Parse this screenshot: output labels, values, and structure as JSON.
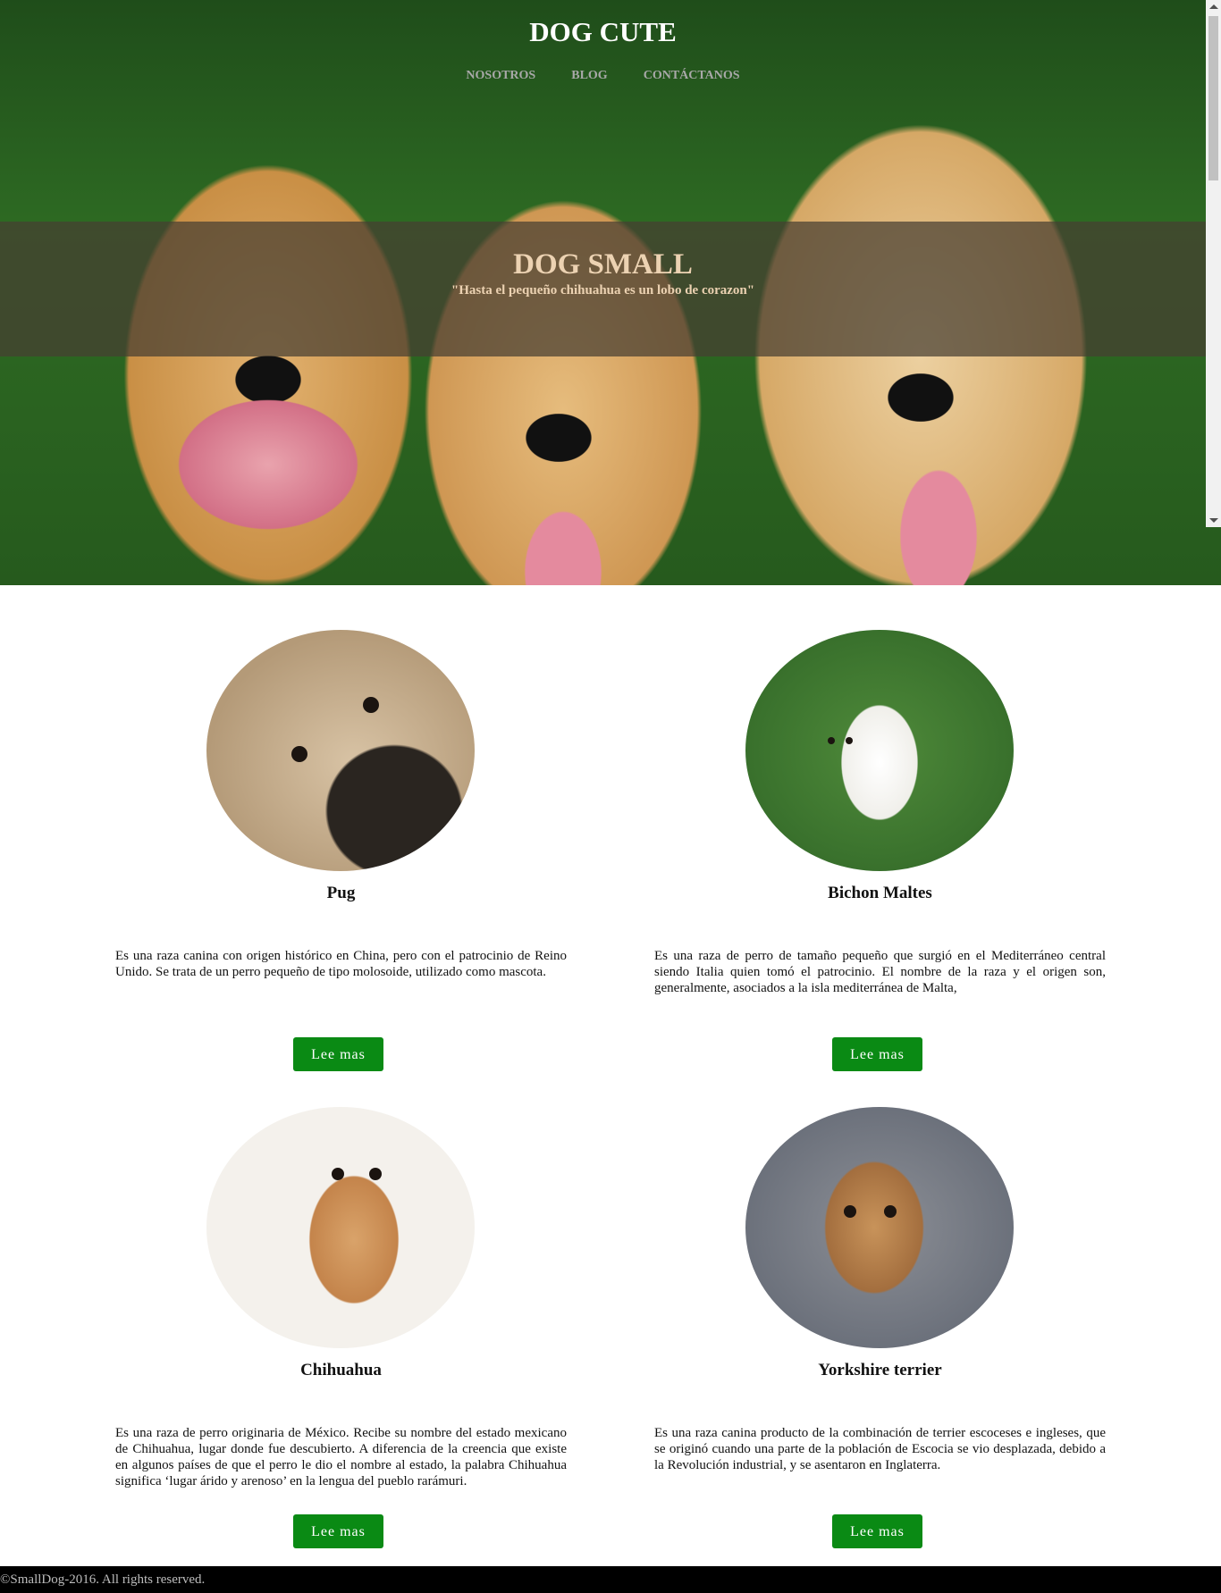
{
  "header": {
    "site_title": "DOG CUTE",
    "nav": [
      "NOSOTROS",
      "BLOG",
      "CONTÁCTANOS"
    ]
  },
  "banner": {
    "title": "DOG SMALL",
    "quote": "\"Hasta el pequeño chihuahua es un lobo de corazon\""
  },
  "dogs": [
    {
      "name": "Pug",
      "description": "Es una raza canina con origen histórico en China, pero con el patrocinio de Reino Unido. Se trata de un perro pequeño de tipo molosoide, utilizado como mascota.",
      "button": "Lee mas"
    },
    {
      "name": "Bichon Maltes",
      "description": "Es una raza de perro de tamaño pequeño que surgió en el Mediterráneo central siendo Italia quien tomó el patrocinio. El nombre de la raza y el origen son, generalmente, asociados a la isla mediterránea de Malta,",
      "button": "Lee mas"
    },
    {
      "name": "Chihuahua",
      "description": "Es una raza de perro originaria de México. Recibe su nombre del estado mexicano de Chihuahua, lugar donde fue descubierto. A diferencia de la creencia que existe en algunos países de que el perro le dio el nombre al estado, la palabra Chihuahua significa ‘lugar árido y arenoso’ en la lengua del pueblo rarámuri.",
      "button": "Lee mas"
    },
    {
      "name": "Yorkshire terrier",
      "description": "Es una raza canina producto de la combinación de terrier escoceses e ingleses, que se originó cuando una parte de la población de Escocia se vio desplazada, debido a la Revolución industrial, y se asentaron en Inglaterra.",
      "button": "Lee mas"
    }
  ],
  "footer": {
    "text": "©SmallDog-2016. All rights reserved."
  },
  "colors": {
    "button_bg": "#0a8a14",
    "footer_bg": "#000000",
    "banner_text": "#ecd2b2"
  }
}
